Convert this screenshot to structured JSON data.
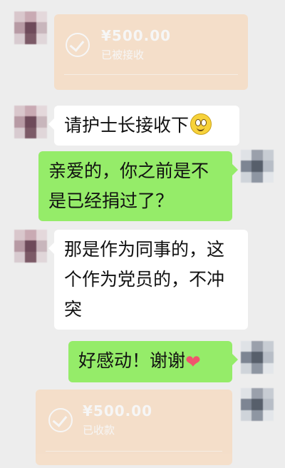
{
  "messages": [
    {
      "type": "transfer",
      "side": "left",
      "amount": "¥500.00",
      "status": "已被接收"
    },
    {
      "type": "text",
      "side": "left",
      "text": "请护士长接收下",
      "emoji": "smile-icon"
    },
    {
      "type": "text",
      "side": "right",
      "line1": "亲爱的，你之前是不",
      "line2": "是已经捐过了？"
    },
    {
      "type": "text",
      "side": "left",
      "line1": "那是作为同事的，这",
      "line2": "个作为党员的，不冲",
      "line3": "突"
    },
    {
      "type": "text",
      "side": "right",
      "text": "好感动！谢谢",
      "emoji": "heart-icon",
      "heart_glyph": "❤"
    },
    {
      "type": "transfer",
      "side": "right",
      "amount": "¥500.00",
      "status": "已收款"
    }
  ],
  "colors": {
    "background": "#ededed",
    "bubble_in": "#ffffff",
    "bubble_out": "#95ec69",
    "transfer_card": "#fbd3ad"
  }
}
